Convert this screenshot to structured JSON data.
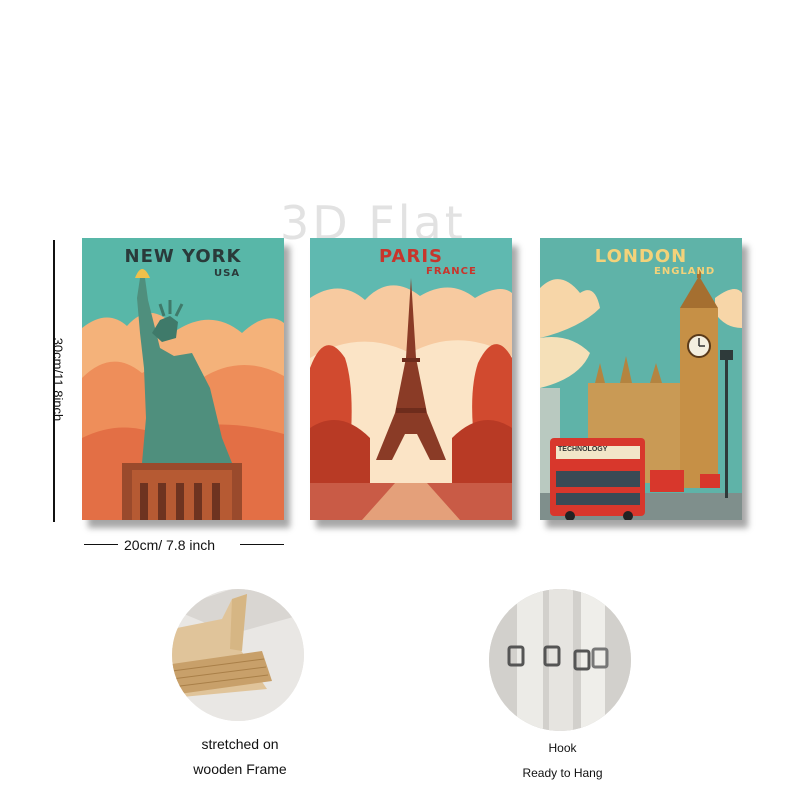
{
  "watermark": "3D Flat",
  "posters": [
    {
      "city": "NEW YORK",
      "country": "USA"
    },
    {
      "city": "PARIS",
      "country": "FRANCE"
    },
    {
      "city": "LONDON",
      "country": "ENGLAND"
    }
  ],
  "bus_sign": "TECHNOLOGY",
  "dimensions": {
    "height_label": "30cm/11.8inch",
    "width_label": "20cm/ 7.8 inch"
  },
  "features": [
    {
      "lines": [
        "stretched on",
        "wooden Frame"
      ]
    },
    {
      "lines": [
        "Hook",
        "Ready to Hang"
      ]
    }
  ]
}
